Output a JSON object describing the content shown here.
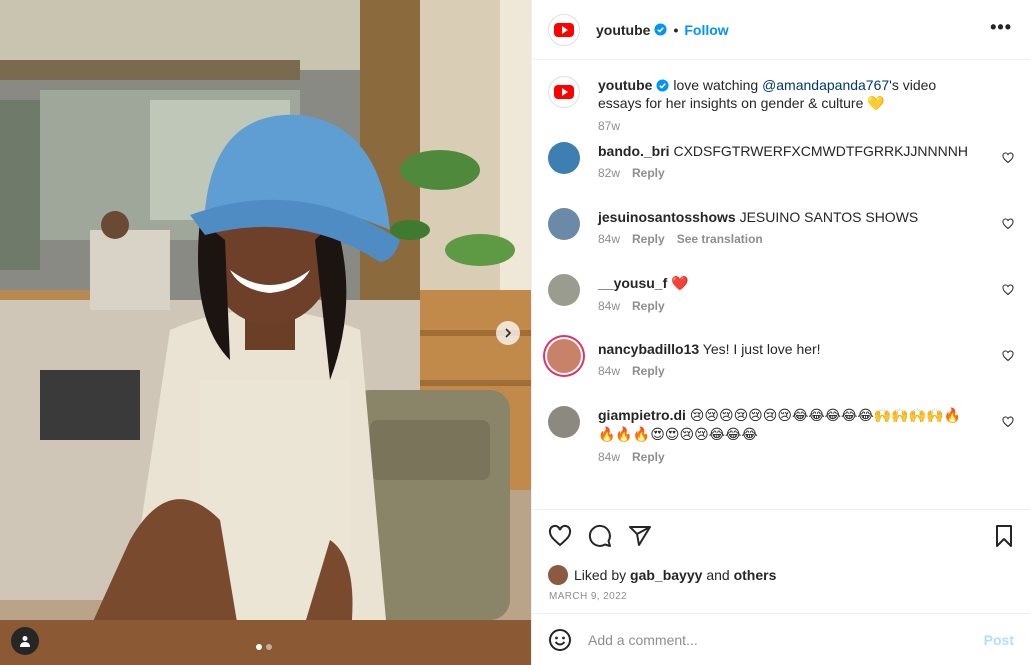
{
  "post": {
    "author": "youtube",
    "follow_label": "Follow",
    "more_label": "•••",
    "separator": "•"
  },
  "caption": {
    "user": "youtube",
    "text_before": " love watching ",
    "mention": "@amandapanda767",
    "text_after": "'s video essays for her insights on gender & culture ",
    "emoji": "💛",
    "time": "87w"
  },
  "comments": [
    {
      "user": "bando._bri",
      "text": "CXDSFGTRWERFXCMWDTFGRRKJJNNNNH",
      "time": "82w",
      "reply": "Reply",
      "translation": ""
    },
    {
      "user": "jesuinosantosshows",
      "text": "JESUINO SANTOS SHOWS",
      "time": "84w",
      "reply": "Reply",
      "translation": "See translation"
    },
    {
      "user": "__yousu_f",
      "text": "❤️",
      "time": "84w",
      "reply": "Reply",
      "translation": ""
    },
    {
      "user": "nancybadillo13",
      "text": "Yes! I just love her!",
      "time": "84w",
      "reply": "Reply",
      "translation": ""
    },
    {
      "user": "giampietro.di",
      "text": "😢😢😢😢😢😢😢😂😂😂😂😂🙌🙌🙌🙌🔥🔥🔥🔥😍😍😢😢😂😂😂",
      "time": "84w",
      "reply": "Reply",
      "translation": ""
    }
  ],
  "likes": {
    "prefix": "Liked by ",
    "user": "gab_bayyy",
    "middle": " and ",
    "others": "others"
  },
  "date": "MARCH 9, 2022",
  "composer": {
    "placeholder": "Add a comment...",
    "post_label": "Post"
  },
  "colors": {
    "accent": "#0095f6",
    "youtube_red": "#ff0000",
    "post_disabled": "#b2dffc",
    "like_red": "#ed4956"
  },
  "icons": [
    "verified-badge-icon",
    "more-options-icon",
    "heart-icon",
    "comment-icon",
    "share-icon",
    "bookmark-icon",
    "emoji-icon",
    "chevron-right-icon",
    "user-tag-icon"
  ]
}
